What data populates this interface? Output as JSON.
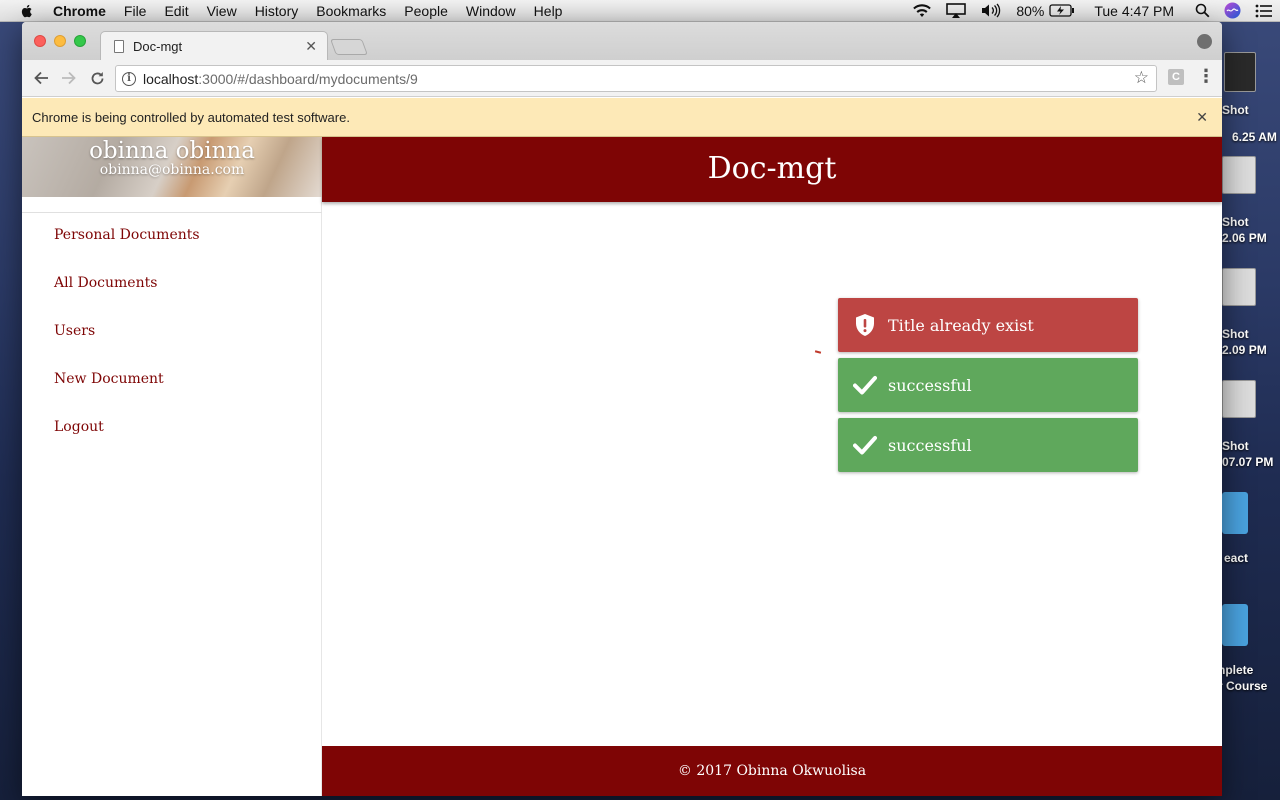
{
  "menubar": {
    "app_name": "Chrome",
    "items": [
      "File",
      "Edit",
      "View",
      "History",
      "Bookmarks",
      "People",
      "Window",
      "Help"
    ],
    "battery": "80%",
    "clock": "Tue 4:47 PM"
  },
  "desktop": {
    "labels": [
      "Shot",
      "Shot",
      "6.25 AM",
      "Shot",
      "2.06 PM",
      "Shot",
      "2.09 PM",
      "Shot",
      "07.07 PM",
      "eact",
      "nplete",
      "r Course"
    ]
  },
  "browser": {
    "tab_title": "Doc-mgt",
    "url_host": "localhost",
    "url_path": ":3000/#/dashboard/mydocuments/9",
    "infobar_text": "Chrome is being controlled by automated test software.",
    "extension_letter": "C"
  },
  "app": {
    "user_name": "obinna obinna",
    "user_email": "obinna@obinna.com",
    "nav": [
      "Personal Documents",
      "All Documents",
      "Users",
      "New Document",
      "Logout"
    ],
    "header_title": "Doc-mgt",
    "footer_text": "© 2017 Obinna Okwuolisa",
    "brand_color": "#7e0505"
  },
  "toasts": [
    {
      "type": "error",
      "message": "Title already exist",
      "color": "#bd4543"
    },
    {
      "type": "success",
      "message": "successful",
      "color": "#5fa85c"
    },
    {
      "type": "success",
      "message": "successful",
      "color": "#5fa85c"
    }
  ]
}
